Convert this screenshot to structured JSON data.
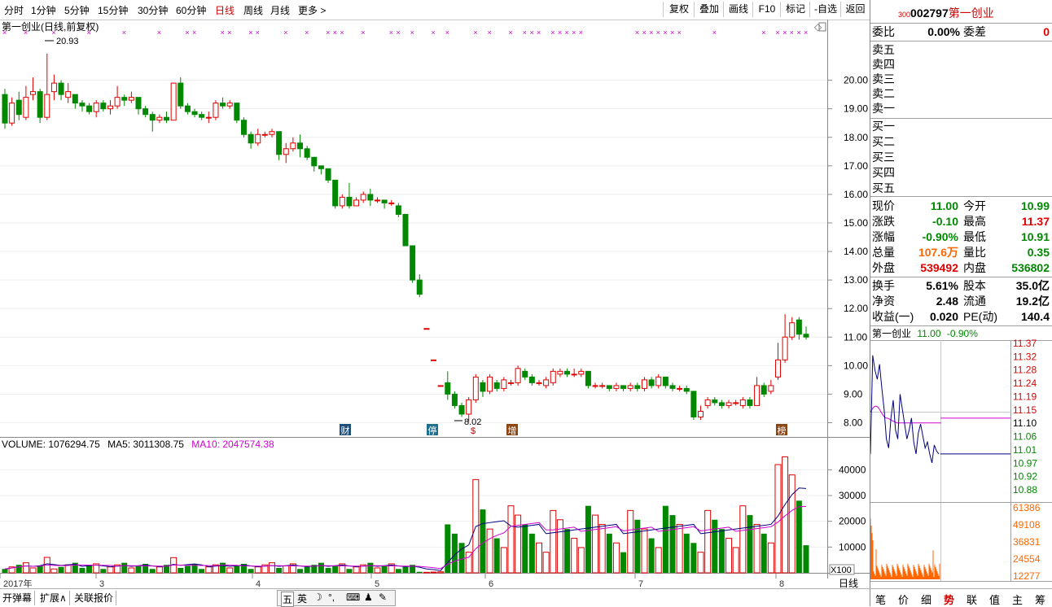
{
  "periods": [
    "分时",
    "1分钟",
    "5分钟",
    "15分钟",
    "30分钟",
    "60分钟",
    "日线",
    "周线",
    "月线",
    "更多 >"
  ],
  "active_period": "日线",
  "toolbar": [
    "复权",
    "叠加",
    "画线",
    "F10",
    "标记",
    "-自选",
    "返回"
  ],
  "chart": {
    "title": "第一创业(日线,前复权)",
    "high_label": "20.93",
    "low_label": "8.02",
    "price_ticks": [
      "20.00",
      "19.00",
      "18.00",
      "17.00",
      "16.00",
      "15.00",
      "14.00",
      "13.00",
      "12.00",
      "11.00",
      "10.00",
      "9.00",
      "8.00"
    ],
    "badges": [
      "财",
      "停",
      "$",
      "增",
      "榜"
    ],
    "volume_header": {
      "label": "VOLUME: 1076294.75",
      "ma5": "MA5: 3011308.75",
      "ma10": "MA10: 2047574.38"
    },
    "volume_ticks": [
      "40000",
      "30000",
      "20000",
      "10000"
    ],
    "volume_unit": "X100",
    "date_labels": [
      "2017年",
      "3",
      "4",
      "5",
      "6",
      "7",
      "8"
    ],
    "period_tag": "日线"
  },
  "chart_data": {
    "type": "candlestick",
    "title": "第一创业(日线,前复权)",
    "ylim": [
      7.7,
      21.5
    ],
    "candles": [
      [
        19.5,
        18.5,
        19.7,
        18.3
      ],
      [
        18.5,
        19.2,
        19.4,
        18.4
      ],
      [
        19.3,
        18.8,
        19.6,
        18.6
      ],
      [
        18.7,
        19.4,
        19.8,
        18.6
      ],
      [
        19.5,
        19.6,
        20.1,
        19.3
      ],
      [
        19.6,
        18.7,
        19.7,
        18.5
      ],
      [
        18.7,
        19.5,
        20.93,
        18.6
      ],
      [
        19.6,
        19.9,
        20.2,
        19.3
      ],
      [
        19.9,
        19.5,
        20.0,
        19.3
      ],
      [
        19.4,
        19.6,
        19.9,
        19.2
      ],
      [
        19.5,
        19.2,
        19.5,
        19.0
      ],
      [
        19.2,
        19.1,
        19.3,
        18.9
      ],
      [
        19.1,
        18.9,
        19.2,
        18.8
      ],
      [
        18.9,
        19.2,
        19.3,
        18.7
      ],
      [
        19.2,
        19.0,
        19.3,
        18.9
      ],
      [
        19.0,
        19.1,
        19.3,
        18.8
      ],
      [
        19.1,
        19.4,
        19.8,
        19.0
      ],
      [
        19.4,
        19.3,
        19.5,
        19.1
      ],
      [
        19.3,
        19.4,
        19.6,
        19.2
      ],
      [
        19.4,
        19.0,
        19.4,
        18.8
      ],
      [
        19.0,
        18.8,
        19.1,
        18.7
      ],
      [
        18.8,
        18.6,
        18.9,
        18.2
      ],
      [
        18.6,
        18.7,
        18.8,
        18.5
      ],
      [
        18.7,
        18.6,
        18.9,
        18.5
      ],
      [
        18.6,
        19.9,
        19.9,
        18.6
      ],
      [
        19.9,
        19.1,
        20.1,
        19.0
      ],
      [
        19.1,
        18.9,
        19.2,
        18.8
      ],
      [
        18.9,
        18.8,
        19.0,
        18.7
      ],
      [
        18.8,
        18.7,
        18.9,
        18.6
      ],
      [
        18.7,
        18.7,
        18.9,
        18.5
      ],
      [
        18.7,
        19.2,
        19.3,
        18.6
      ],
      [
        19.2,
        19.1,
        19.4,
        19.0
      ],
      [
        19.1,
        19.2,
        19.3,
        19.0
      ],
      [
        19.2,
        18.6,
        19.2,
        18.5
      ],
      [
        18.6,
        18.1,
        18.7,
        18.0
      ],
      [
        18.1,
        17.8,
        18.2,
        17.6
      ],
      [
        17.8,
        18.1,
        18.3,
        17.7
      ],
      [
        18.1,
        18.1,
        18.2,
        18.0
      ],
      [
        18.1,
        18.2,
        18.3,
        18.0
      ],
      [
        18.2,
        17.4,
        18.2,
        17.2
      ],
      [
        17.4,
        17.6,
        17.8,
        17.1
      ],
      [
        17.6,
        17.8,
        18.0,
        17.5
      ],
      [
        17.8,
        17.6,
        18.1,
        17.3
      ],
      [
        17.6,
        17.3,
        17.7,
        17.2
      ],
      [
        17.3,
        17.0,
        17.3,
        16.8
      ],
      [
        17.0,
        16.9,
        17.0,
        16.7
      ],
      [
        16.9,
        16.5,
        16.9,
        16.4
      ],
      [
        16.5,
        15.6,
        16.5,
        15.5
      ],
      [
        15.6,
        15.9,
        16.0,
        15.5
      ],
      [
        15.9,
        15.6,
        16.4,
        15.5
      ],
      [
        15.6,
        15.8,
        15.9,
        15.6
      ],
      [
        15.8,
        16.0,
        16.1,
        15.7
      ],
      [
        16.0,
        15.8,
        16.2,
        15.6
      ],
      [
        15.8,
        15.8,
        15.9,
        15.7
      ],
      [
        15.8,
        15.7,
        15.8,
        15.5
      ],
      [
        15.7,
        15.7,
        15.8,
        15.6
      ],
      [
        15.6,
        15.3,
        15.7,
        15.2
      ],
      [
        15.3,
        14.2,
        15.3,
        14.2
      ],
      [
        14.2,
        13.0,
        14.2,
        12.9
      ],
      [
        13.0,
        12.5,
        13.2,
        12.4
      ],
      [
        11.3,
        11.3,
        11.3,
        11.3
      ],
      [
        10.2,
        10.2,
        10.2,
        10.2
      ],
      [
        9.3,
        9.3,
        9.3,
        9.3
      ],
      [
        9.4,
        9.0,
        9.8,
        8.8
      ],
      [
        9.0,
        8.6,
        9.1,
        8.5
      ],
      [
        8.6,
        8.3,
        8.7,
        8.2
      ],
      [
        8.3,
        8.8,
        8.9,
        8.02
      ],
      [
        8.8,
        9.6,
        9.7,
        8.7
      ],
      [
        9.4,
        9.1,
        9.5,
        8.9
      ],
      [
        9.1,
        9.6,
        9.7,
        9.0
      ],
      [
        9.4,
        9.2,
        9.5,
        9.1
      ],
      [
        9.2,
        9.5,
        9.6,
        9.1
      ],
      [
        9.4,
        9.4,
        9.5,
        9.3
      ],
      [
        9.4,
        9.9,
        10.0,
        9.3
      ],
      [
        9.8,
        9.6,
        9.9,
        9.5
      ],
      [
        9.6,
        9.4,
        9.7,
        9.3
      ],
      [
        9.4,
        9.4,
        9.5,
        9.3
      ],
      [
        9.3,
        9.5,
        9.6,
        9.2
      ],
      [
        9.4,
        9.8,
        9.9,
        9.3
      ],
      [
        9.7,
        9.8,
        9.9,
        9.6
      ],
      [
        9.8,
        9.7,
        9.9,
        9.6
      ],
      [
        9.7,
        9.7,
        9.9,
        9.6
      ],
      [
        9.7,
        9.8,
        9.9,
        9.6
      ],
      [
        9.8,
        9.3,
        9.8,
        9.2
      ],
      [
        9.3,
        9.3,
        9.4,
        9.2
      ],
      [
        9.3,
        9.3,
        9.4,
        9.2
      ],
      [
        9.3,
        9.2,
        9.3,
        9.1
      ],
      [
        9.2,
        9.3,
        9.4,
        9.1
      ],
      [
        9.3,
        9.2,
        9.3,
        9.1
      ],
      [
        9.2,
        9.3,
        9.4,
        9.1
      ],
      [
        9.3,
        9.2,
        9.4,
        9.1
      ],
      [
        9.2,
        9.5,
        9.6,
        9.1
      ],
      [
        9.5,
        9.3,
        9.6,
        9.2
      ],
      [
        9.3,
        9.6,
        9.7,
        9.2
      ],
      [
        9.6,
        9.3,
        9.6,
        9.2
      ],
      [
        9.3,
        9.2,
        9.4,
        9.1
      ],
      [
        9.2,
        9.2,
        9.3,
        9.1
      ],
      [
        9.2,
        9.1,
        9.3,
        9.0
      ],
      [
        9.1,
        8.2,
        9.1,
        8.1
      ],
      [
        8.2,
        8.4,
        8.6,
        8.1
      ],
      [
        8.6,
        8.8,
        8.9,
        8.5
      ],
      [
        8.8,
        8.7,
        8.9,
        8.6
      ],
      [
        8.7,
        8.6,
        8.8,
        8.5
      ],
      [
        8.6,
        8.7,
        8.8,
        8.5
      ],
      [
        8.7,
        8.7,
        8.8,
        8.6
      ],
      [
        8.6,
        8.8,
        8.9,
        8.5
      ],
      [
        8.8,
        8.6,
        8.9,
        8.5
      ],
      [
        8.6,
        9.3,
        9.6,
        8.6
      ],
      [
        9.3,
        9.0,
        9.4,
        8.9
      ],
      [
        9.1,
        9.3,
        9.5,
        9.0
      ],
      [
        9.6,
        10.2,
        10.8,
        9.5
      ],
      [
        10.2,
        11.0,
        11.8,
        10.1
      ],
      [
        11.0,
        11.5,
        11.7,
        10.9
      ],
      [
        11.6,
        11.1,
        11.7,
        10.91
      ],
      [
        11.1,
        11.0,
        11.37,
        10.91
      ]
    ],
    "volume_ylim": [
      0,
      48000
    ]
  },
  "right_panel": {
    "code_prefix": "300",
    "code": "002797",
    "name": "第一创业",
    "webi": {
      "l1": "委比",
      "v1": "0.00%",
      "l2": "委差",
      "v2": "0"
    },
    "sell": [
      "卖五",
      "卖四",
      "卖三",
      "卖二",
      "卖一"
    ],
    "buy": [
      "买一",
      "买二",
      "买三",
      "买四",
      "买五"
    ],
    "quotes": [
      {
        "l1": "现价",
        "v1": "11.00",
        "c1": "green",
        "l2": "今开",
        "v2": "10.99",
        "c2": "green"
      },
      {
        "l1": "涨跌",
        "v1": "-0.10",
        "c1": "green",
        "l2": "最高",
        "v2": "11.37",
        "c2": "red"
      },
      {
        "l1": "涨幅",
        "v1": "-0.90%",
        "c1": "green",
        "l2": "最低",
        "v2": "10.91",
        "c2": "green"
      },
      {
        "l1": "总量",
        "v1": "107.6万",
        "c1": "orange",
        "l2": "量比",
        "v2": "0.35",
        "c2": "green"
      },
      {
        "l1": "外盘",
        "v1": "539492",
        "c1": "red",
        "l2": "内盘",
        "v2": "536802",
        "c2": "green"
      }
    ],
    "fundamentals": [
      {
        "l1": "换手",
        "v1": "5.61%",
        "l2": "股本",
        "v2": "35.0亿"
      },
      {
        "l1": "净资",
        "v1": "2.48",
        "l2": "流通",
        "v2": "19.2亿"
      },
      {
        "l1": "收益(一)",
        "v1": "0.020",
        "l2": "PE(动)",
        "v2": "140.4"
      }
    ],
    "mini": {
      "name": "第一创业",
      "price": "11.00",
      "change": "-0.90%",
      "price_ticks": [
        "11.37",
        "11.32",
        "11.28",
        "11.24",
        "11.19",
        "11.15",
        "11.10",
        "11.06",
        "11.01",
        "10.97",
        "10.92",
        "10.88"
      ],
      "vol_ticks": [
        "61386",
        "49108",
        "36831",
        "24554",
        "12277"
      ]
    },
    "tabs": [
      "笔",
      "价",
      "细",
      "势",
      "联",
      "值",
      "主",
      "筹"
    ],
    "active_tab": "势"
  },
  "bottom": {
    "buttons": [
      "开弹幕",
      "扩展∧",
      "关联报价"
    ],
    "ime": [
      "五",
      "英",
      "☽",
      "°,",
      "⌨",
      "♟",
      "✎"
    ]
  }
}
